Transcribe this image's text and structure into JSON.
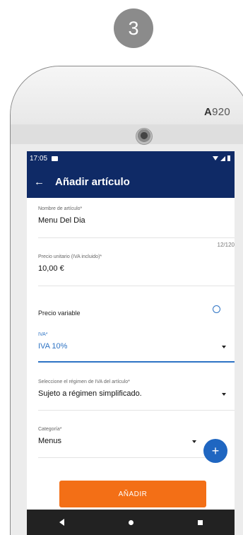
{
  "step": "3",
  "device": {
    "brand_bold": "A",
    "brand_rest": "920"
  },
  "status_bar": {
    "time": "17:05"
  },
  "app_bar": {
    "title": "Añadir artículo"
  },
  "form": {
    "name": {
      "label": "Nombre de artículo*",
      "value": "Menu Del Dia",
      "counter": "12/120"
    },
    "price": {
      "label": "Precio unitario (IVA incluido)*",
      "value": "10,00 €"
    },
    "variable_price": {
      "label": "Precio variable"
    },
    "iva": {
      "label": "IVA*",
      "value": "IVA 10%"
    },
    "regimen": {
      "label": "Seleccione el régimen de IVA del artículo*",
      "value": "Sujeto a régimen simplificado."
    },
    "category": {
      "label": "Categoría*",
      "value": "Menus"
    },
    "add_button": "AÑADIR"
  },
  "colors": {
    "primary": "#0f2a66",
    "accent": "#2d73c4",
    "button": "#f36f16",
    "fab": "#1f66c1"
  },
  "icons": {
    "back": "arrow-left-icon",
    "add": "plus-icon",
    "dropdown": "chevron-down-icon",
    "radio": "radio-circle-icon"
  }
}
